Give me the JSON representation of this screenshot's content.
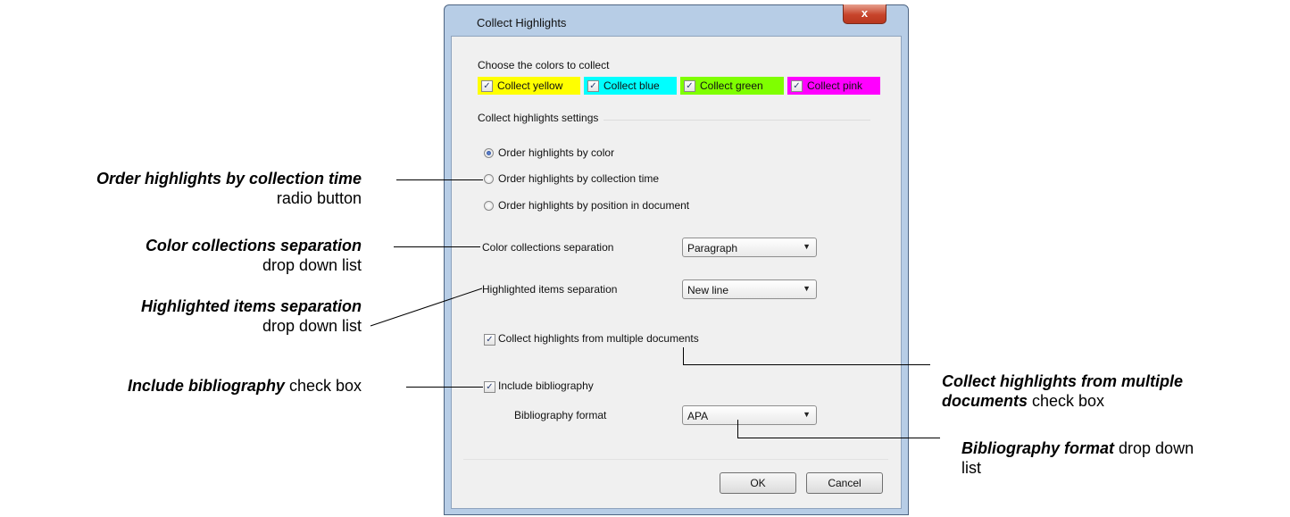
{
  "dialog": {
    "title": "Collect Highlights",
    "close_glyph": "x",
    "colors_heading": "Choose the colors to collect",
    "colors": [
      {
        "label": "Collect yellow",
        "checked": true,
        "color": "#ffff00"
      },
      {
        "label": "Collect blue",
        "checked": true,
        "color": "#00ffff"
      },
      {
        "label": "Collect green",
        "checked": true,
        "color": "#7fff00"
      },
      {
        "label": "Collect pink",
        "checked": true,
        "color": "#ff00ff"
      }
    ],
    "settings_heading": "Collect highlights settings",
    "order_options": [
      {
        "label": "Order highlights by color",
        "selected": true
      },
      {
        "label": "Order highlights by collection time",
        "selected": false
      },
      {
        "label": "Order highlights by position in document",
        "selected": false
      }
    ],
    "color_sep_label": "Color collections separation",
    "color_sep_value": "Paragraph",
    "item_sep_label": "Highlighted items separation",
    "item_sep_value": "New line",
    "multi_docs_label": "Collect highlights from multiple documents",
    "multi_docs_checked": true,
    "include_bib_label": "Include bibliography",
    "include_bib_checked": true,
    "bib_format_label": "Bibliography format",
    "bib_format_value": "APA",
    "ok_label": "OK",
    "cancel_label": "Cancel",
    "check_glyph": "✓",
    "dropdown_glyph": "▼"
  },
  "annotations": {
    "order_time_bold": "Order highlights by collection time",
    "order_time_rest": "radio button",
    "color_sep_bold": "Color collections separation",
    "color_sep_rest": "drop down list",
    "item_sep_bold": "Highlighted items separation",
    "item_sep_rest": "drop down list",
    "include_bib_bold": "Include bibliography",
    "include_bib_rest": " check box",
    "multi_docs_bold_1": "Collect highlights from multiple",
    "multi_docs_bold_2": "documents",
    "multi_docs_rest": " check box",
    "bib_format_bold": "Bibliography format",
    "bib_format_rest": " drop down",
    "bib_format_rest_2": "list"
  }
}
